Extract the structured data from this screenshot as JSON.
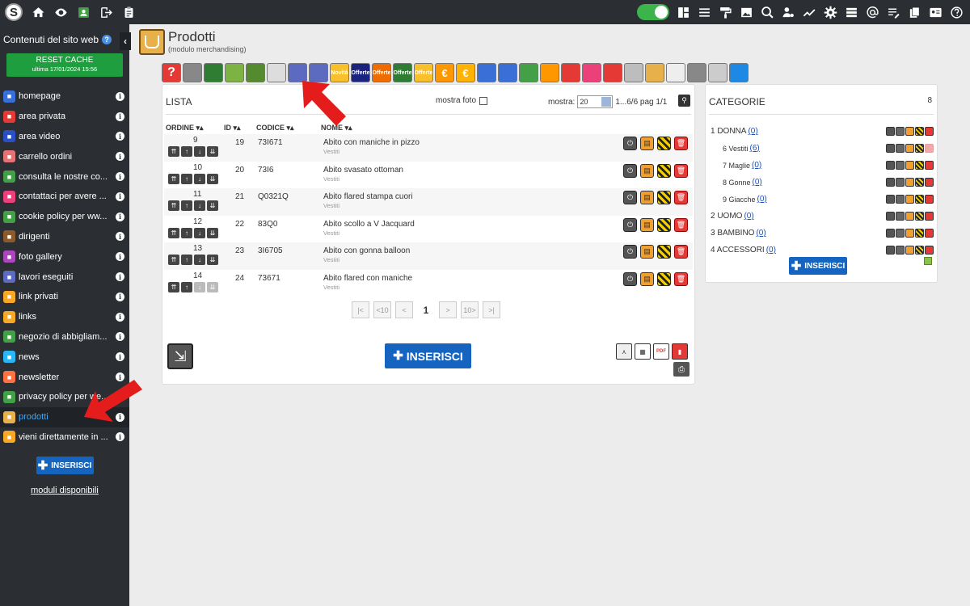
{
  "topbar": {
    "logo": "S",
    "left_icons": [
      "home-icon",
      "eye-icon",
      "user-card-icon",
      "logout-icon",
      "clipboard-icon"
    ],
    "right_icons": [
      "layout-icon",
      "menu-icon",
      "paint-roller-icon",
      "image-icon",
      "search-gear-icon",
      "user-gear-icon",
      "chart-icon",
      "settings-icon",
      "list-icon",
      "at-icon",
      "text-icon",
      "documents-icon",
      "id-card-icon",
      "help-icon"
    ]
  },
  "sidebar": {
    "title": "Contenuti del sito web",
    "reset_label": "RESET CACHE",
    "reset_sub": "ultima 17/01/2024 15:56",
    "items": [
      {
        "label": "homepage",
        "color": "#3b6fd8"
      },
      {
        "label": "area privata",
        "color": "#e53935"
      },
      {
        "label": "area video",
        "color": "#2950c4"
      },
      {
        "label": "carrello ordini",
        "color": "#e57373"
      },
      {
        "label": "consulta le nostre co...",
        "color": "#43a047"
      },
      {
        "label": "contattaci per avere ...",
        "color": "#ec407a"
      },
      {
        "label": "cookie policy per ww...",
        "color": "#43a047"
      },
      {
        "label": "dirigenti",
        "color": "#8d5a2b"
      },
      {
        "label": "foto gallery",
        "color": "#ab47bc"
      },
      {
        "label": "lavori eseguiti",
        "color": "#5c6bc0"
      },
      {
        "label": "link privati",
        "color": "#f9a825"
      },
      {
        "label": "links",
        "color": "#f9a825"
      },
      {
        "label": "negozio di abbigliam...",
        "color": "#43a047"
      },
      {
        "label": "news",
        "color": "#29b6f6"
      },
      {
        "label": "newsletter",
        "color": "#ff7043"
      },
      {
        "label": "privacy policy per we...",
        "color": "#43a047"
      },
      {
        "label": "prodotti",
        "color": "#e8b04a",
        "active": true
      },
      {
        "label": "vieni direttamente in ...",
        "color": "#f9a825"
      }
    ],
    "insert_label": "INSERISCI",
    "moduli_label": "moduli disponibili"
  },
  "page": {
    "title": "Prodotti",
    "subtitle": "(modulo merchandising)"
  },
  "toolbar": {
    "buttons": [
      {
        "name": "help",
        "color": "#e53935",
        "text": "?"
      },
      {
        "name": "robot",
        "color": "#888",
        "text": ""
      },
      {
        "name": "banner-green",
        "color": "#2e7d32",
        "text": ""
      },
      {
        "name": "banner-download",
        "color": "#7cb342",
        "text": ""
      },
      {
        "name": "banner-facebook",
        "color": "#558b2f",
        "text": ""
      },
      {
        "name": "sign",
        "color": "#ddd",
        "text": ""
      },
      {
        "name": "shirt-1",
        "color": "#5c6bc0",
        "text": ""
      },
      {
        "name": "shirt-2",
        "color": "#5c6bc0",
        "text": ""
      },
      {
        "name": "novita",
        "color": "#f9c02e",
        "text": "Novità"
      },
      {
        "name": "offerte-1",
        "color": "#1a237e",
        "text": "Offerte"
      },
      {
        "name": "offerte-2",
        "color": "#ef6c00",
        "text": "Offerte"
      },
      {
        "name": "offerte-3",
        "color": "#2e7d32",
        "text": "Offerte"
      },
      {
        "name": "offerte-4",
        "color": "#f9c02e",
        "text": "Offerte"
      },
      {
        "name": "euro-1",
        "color": "#ff9800",
        "text": "€"
      },
      {
        "name": "euro-2",
        "color": "#ffb300",
        "text": "€"
      },
      {
        "name": "cart-1",
        "color": "#3b6fd8",
        "text": ""
      },
      {
        "name": "cart-2",
        "color": "#3b6fd8",
        "text": ""
      },
      {
        "name": "card",
        "color": "#43a047",
        "text": ""
      },
      {
        "name": "checklist",
        "color": "#ff9800",
        "text": ""
      },
      {
        "name": "tags",
        "color": "#e53935",
        "text": ""
      },
      {
        "name": "document-pink",
        "color": "#ec407a",
        "text": ""
      },
      {
        "name": "tag-red",
        "color": "#e53935",
        "text": ""
      },
      {
        "name": "edit-grey",
        "color": "#bdbdbd",
        "text": ""
      },
      {
        "name": "shop-bag",
        "color": "#e8b04a",
        "text": ""
      },
      {
        "name": "add-row",
        "color": "#eee",
        "text": ""
      },
      {
        "name": "filter",
        "color": "#888",
        "text": ""
      },
      {
        "name": "people",
        "color": "#ccc",
        "text": ""
      },
      {
        "name": "globe",
        "color": "#1e88e5",
        "text": ""
      }
    ]
  },
  "lista": {
    "title": "LISTA",
    "show_photo_label": "mostra foto",
    "show_label": "mostra:",
    "per_page": "20",
    "page_info": "1...6/6 pag 1/1",
    "columns": {
      "ordine": "ORDINE",
      "id": "ID",
      "codice": "CODICE",
      "nome": "NOME"
    },
    "rows": [
      {
        "ordine": "9",
        "id": "19",
        "codice": "73I671",
        "nome": "Abito con maniche in pizzo",
        "categoria": "Vestiti"
      },
      {
        "ordine": "10",
        "id": "20",
        "codice": "73I6",
        "nome": "Abito svasato ottoman",
        "categoria": "Vestiti"
      },
      {
        "ordine": "11",
        "id": "21",
        "codice": "Q0321Q",
        "nome": "Abito flared stampa cuori",
        "categoria": "Vestiti"
      },
      {
        "ordine": "12",
        "id": "22",
        "codice": "83Q0",
        "nome": "Abito scollo a V Jacquard",
        "categoria": "Vestiti"
      },
      {
        "ordine": "13",
        "id": "23",
        "codice": "3I6705",
        "nome": "Abito con gonna balloon",
        "categoria": "Vestiti"
      },
      {
        "ordine": "14",
        "id": "24",
        "codice": "73671",
        "nome": "Abito flared con maniche",
        "categoria": "Vestiti"
      }
    ],
    "pager": {
      "first": "|<",
      "back10": "<10",
      "prev": "<",
      "current": "1",
      "next": ">",
      "fwd10": "10>",
      "last": ">|"
    },
    "insert_label": "INSERISCI"
  },
  "categorie": {
    "title": "CATEGORIE",
    "count": "8",
    "items": [
      {
        "label": "1 DONNA",
        "count": "(0)",
        "level": 0
      },
      {
        "label": "6 Vestiti",
        "count": "(6)",
        "level": 1
      },
      {
        "label": "7 Maglie",
        "count": "(0)",
        "level": 1
      },
      {
        "label": "8 Gonne",
        "count": "(0)",
        "level": 1
      },
      {
        "label": "9 Giacche",
        "count": "(0)",
        "level": 1
      },
      {
        "label": "2 UOMO",
        "count": "(0)",
        "level": 0
      },
      {
        "label": "3 BAMBINO",
        "count": "(0)",
        "level": 0
      },
      {
        "label": "4 ACCESSORI",
        "count": "(0)",
        "level": 0
      }
    ],
    "insert_label": "INSERISCI"
  }
}
